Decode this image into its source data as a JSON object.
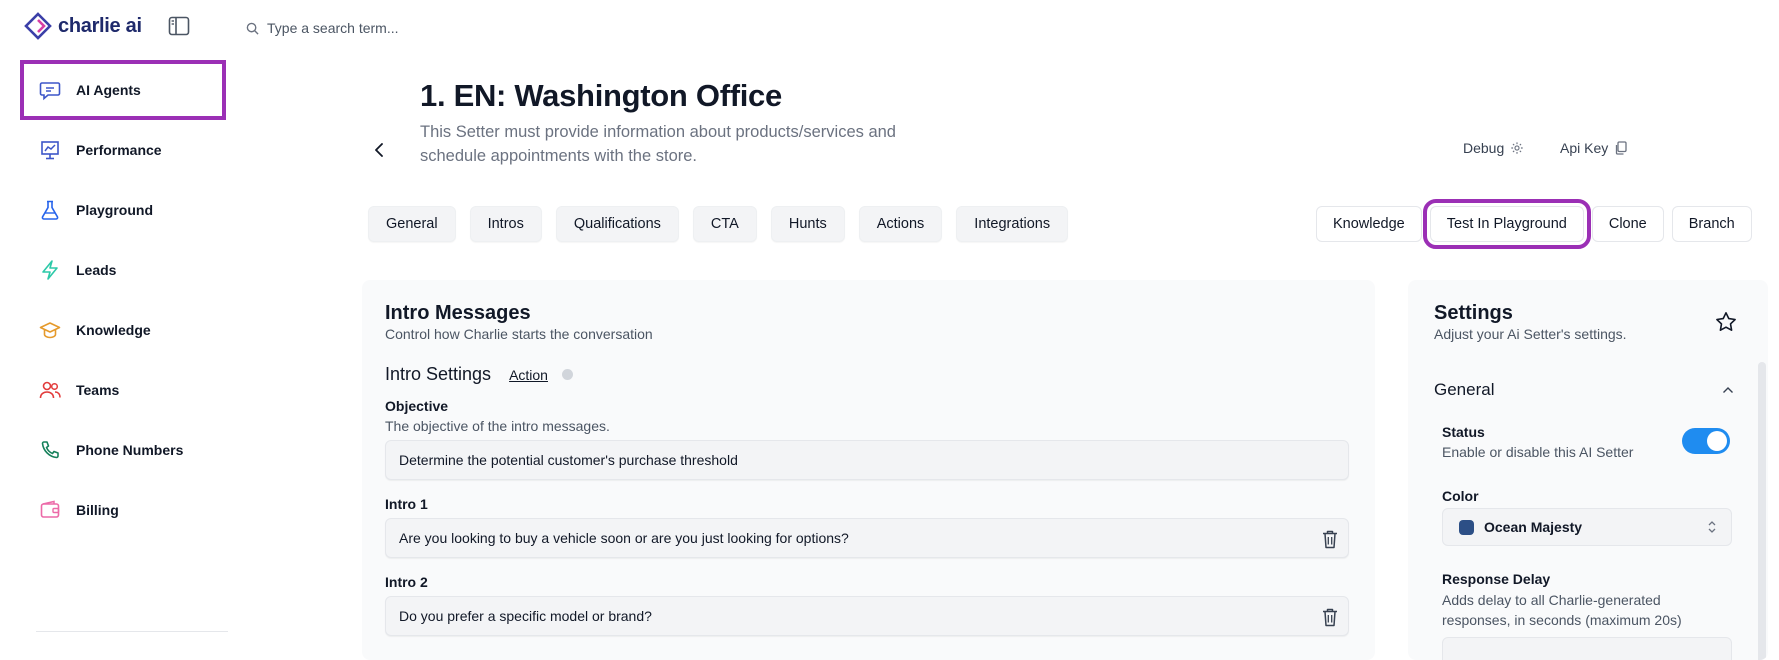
{
  "app": {
    "logo_text": "charlie ai"
  },
  "search": {
    "placeholder": "Type a search term..."
  },
  "sidebar": {
    "items": [
      {
        "label": "AI Agents",
        "icon": "chat-bubble-icon"
      },
      {
        "label": "Performance",
        "icon": "presentation-chart-icon"
      },
      {
        "label": "Playground",
        "icon": "flask-icon"
      },
      {
        "label": "Leads",
        "icon": "lightning-icon"
      },
      {
        "label": "Knowledge",
        "icon": "graduation-cap-icon"
      },
      {
        "label": "Teams",
        "icon": "users-icon"
      },
      {
        "label": "Phone Numbers",
        "icon": "phone-icon"
      },
      {
        "label": "Billing",
        "icon": "wallet-icon"
      }
    ]
  },
  "header": {
    "title": "1. EN: Washington Office",
    "description": "This Setter must provide information about products/services and schedule appointments with the store.",
    "debug_label": "Debug",
    "api_key_label": "Api Key"
  },
  "tabs": [
    "General",
    "Intros",
    "Qualifications",
    "CTA",
    "Hunts",
    "Actions",
    "Integrations"
  ],
  "actions": [
    "Knowledge",
    "Test In Playground",
    "Clone",
    "Branch"
  ],
  "intro_panel": {
    "title": "Intro Messages",
    "subtitle": "Control how Charlie starts the conversation",
    "settings_title": "Intro Settings",
    "action_link": "Action",
    "objective_label": "Objective",
    "objective_help": "The objective of the intro messages.",
    "objective_value": "Determine the potential customer's purchase threshold",
    "intro1_label": "Intro 1",
    "intro1_value": "Are you looking to buy a vehicle soon or are you just looking for options?",
    "intro2_label": "Intro 2",
    "intro2_value": "Do you prefer a specific model or brand?"
  },
  "settings_panel": {
    "title": "Settings",
    "subtitle": "Adjust your Ai Setter's settings.",
    "section_general": "General",
    "status_label": "Status",
    "status_help": "Enable or disable this AI Setter",
    "status_enabled": true,
    "color_label": "Color",
    "color_value": "Ocean Majesty",
    "color_swatch": "#2c4f86",
    "delay_label": "Response Delay",
    "delay_help": "Adds delay to all Charlie-generated responses, in seconds (maximum 20s)"
  },
  "colors": {
    "highlight": "#9b2fb5",
    "toggle_on": "#1f8cf0",
    "brand": "#1f2a6b"
  }
}
